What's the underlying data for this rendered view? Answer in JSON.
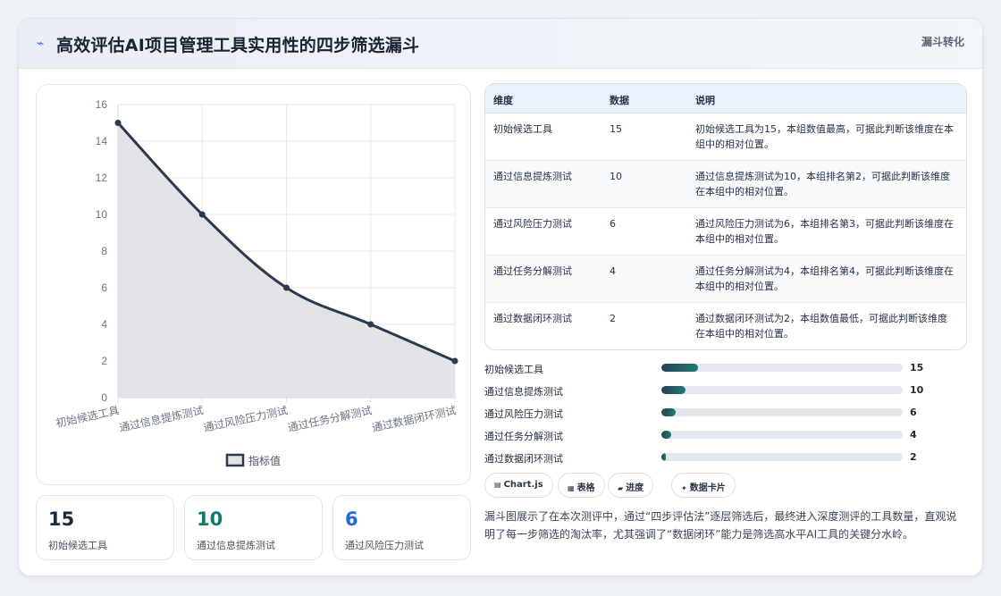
{
  "header": {
    "icon": "lightning-icon",
    "title": "高效评估AI项目管理工具实用性的四步筛选漏斗",
    "badge": "漏斗转化"
  },
  "chart_data": {
    "type": "area",
    "categories": [
      "初始候选工具",
      "通过信息提炼测试",
      "通过风险压力测试",
      "通过任务分解测试",
      "通过数据闭环测试"
    ],
    "series": [
      {
        "name": "指标值",
        "values": [
          15,
          10,
          6,
          4,
          2
        ]
      }
    ],
    "ylim": [
      0,
      16
    ],
    "yticks": [
      0,
      2,
      4,
      6,
      8,
      10,
      12,
      14,
      16
    ],
    "grid": true,
    "legend": "bottom",
    "colors": {
      "line": "#2b3a4e",
      "fill": "#e1e3e6",
      "grid": "#e3e7ee",
      "tick": "#6b7384"
    }
  },
  "stats": [
    {
      "value": "15",
      "label": "初始候选工具",
      "color": "#1f2a3d"
    },
    {
      "value": "10",
      "label": "通过信息提炼测试",
      "color": "#0f7a6c"
    },
    {
      "value": "6",
      "label": "通过风险压力测试",
      "color": "#2566d8"
    }
  ],
  "table": {
    "headers": [
      "维度",
      "数据",
      "说明"
    ],
    "rows": [
      [
        "初始候选工具",
        "15",
        "初始候选工具为15，本组数值最高，可据此判断该维度在本组中的相对位置。"
      ],
      [
        "通过信息提炼测试",
        "10",
        "通过信息提炼测试为10，本组排名第2，可据此判断该维度在本组中的相对位置。"
      ],
      [
        "通过风险压力测试",
        "6",
        "通过风险压力测试为6，本组排名第3，可据此判断该维度在本组中的相对位置。"
      ],
      [
        "通过任务分解测试",
        "4",
        "通过任务分解测试为4，本组排名第4，可据此判断该维度在本组中的相对位置。"
      ],
      [
        "通过数据闭环测试",
        "2",
        "通过数据闭环测试为2，本组数值最低，可据此判断该维度在本组中的相对位置。"
      ]
    ]
  },
  "bars": {
    "max": 100,
    "items": [
      {
        "label": "初始候选工具",
        "value": 15
      },
      {
        "label": "通过信息提炼测试",
        "value": 10
      },
      {
        "label": "通过风险压力测试",
        "value": 6
      },
      {
        "label": "通过任务分解测试",
        "value": 4
      },
      {
        "label": "通过数据闭环测试",
        "value": 2
      }
    ]
  },
  "tags": [
    {
      "icon": "chart-icon",
      "glyph": "▤",
      "label": "Chart.js"
    },
    {
      "icon": "table-icon",
      "glyph": "▦",
      "label": "表格"
    },
    {
      "icon": "progress-icon",
      "glyph": "▰",
      "label": "进度"
    },
    {
      "icon": "card-icon",
      "glyph": "✦",
      "label": "数据卡片"
    }
  ],
  "summary": "漏斗图展示了在本次测评中，通过“四步评估法”逐层筛选后，最终进入深度测评的工具数量，直观说明了每一步筛选的淘汰率，尤其强调了“数据闭环”能力是筛选高水平AI工具的关键分水岭。"
}
